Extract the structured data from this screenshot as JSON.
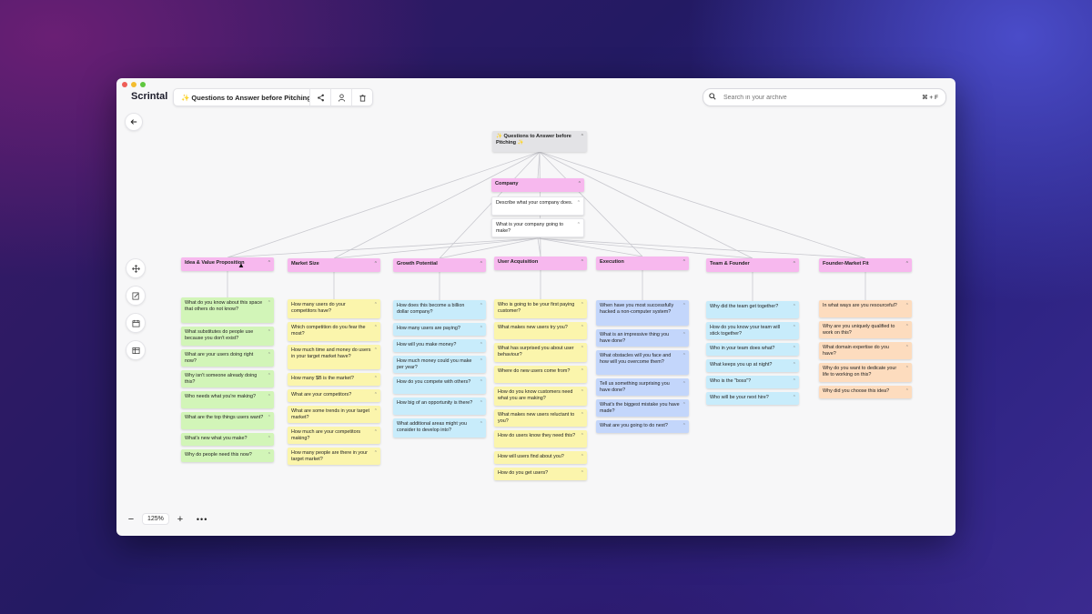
{
  "app": {
    "logo": "Scrintal"
  },
  "header": {
    "doc_title": "✨ Questions to Answer before Pitching ✨",
    "share_icon": "share-icon",
    "person_icon": "person-icon",
    "trash_icon": "trash-icon"
  },
  "search": {
    "placeholder": "Search in your archive",
    "shortcut": "⌘ + F"
  },
  "zoom": {
    "minus": "−",
    "value": "125%",
    "plus": "+",
    "more": "•••"
  },
  "board": {
    "root": "✨ Questions to Answer before Pitching ✨",
    "company": {
      "header": "Company",
      "items": [
        "Describe what your company does.",
        "What is your company going to make?"
      ]
    },
    "columns": [
      {
        "header": "Idea & Value Proposition",
        "color": "green",
        "items": [
          "What do you know about this space that others do not know?",
          "What substitutes do people use because you don't exist?",
          "What are your users doing right now?",
          "Why isn't someone already doing this?",
          "Who needs what you're making?",
          "What are the top things users want?",
          "What's new what you make?",
          "Why do people need this now?"
        ]
      },
      {
        "header": "Market Size",
        "color": "yellow",
        "items": [
          "How many users do your competitors have?",
          "Which competition do you fear the most?",
          "How much time and money do users in your target market have?",
          "How many $B is the market?",
          "What are your competitors?",
          "What are some trends in your target market?",
          "How much are your competitors making?",
          "How many people are there in your target market?"
        ]
      },
      {
        "header": "Growth Potential",
        "color": "cyan",
        "items": [
          "How does this become a billion dollar company?",
          "How many users are paying?",
          "How will you make money?",
          "How much money could you make per year?",
          "How do you compete with others?",
          "How big of an opportunity is there?",
          "What additional areas might you consider to develop into?"
        ]
      },
      {
        "header": "User Acquisition",
        "color": "yellow",
        "items": [
          "Who is going to be your first paying customer?",
          "What makes new users try you?",
          "What has surprised you about user behaviour?",
          "Where do new users come from?",
          "How do you know customers need what you are making?",
          "What makes new users reluctant to you?",
          "How do users know they need this?",
          "How will users find about you?",
          "How do you get users?"
        ]
      },
      {
        "header": "Execution",
        "color": "blue",
        "items": [
          "When have you most successfully hacked a non-computer system?",
          "What is an impressive thing you have done?",
          "What obstacles will you face and how will you overcome them?",
          "Tell us something surprising you have done?",
          "What's the biggest mistake you have made?",
          "What are you going to do next?"
        ]
      },
      {
        "header": "Team & Founder",
        "color": "cyan",
        "items": [
          "Why did the team get together?",
          "How do you know your team will stick together?",
          "Who in your team does what?",
          "What keeps you up at night?",
          "Who is the \"boss\"?",
          "Who will be your next hire?"
        ]
      },
      {
        "header": "Founder-Market Fit",
        "color": "orange",
        "items": [
          "In what ways are you resourceful?",
          "Why are you uniquely qualified to work on this?",
          "What domain expertise do you have?",
          "Why do you want to dedicate your life to working on this?",
          "Why did you choose this idea?"
        ]
      }
    ]
  }
}
